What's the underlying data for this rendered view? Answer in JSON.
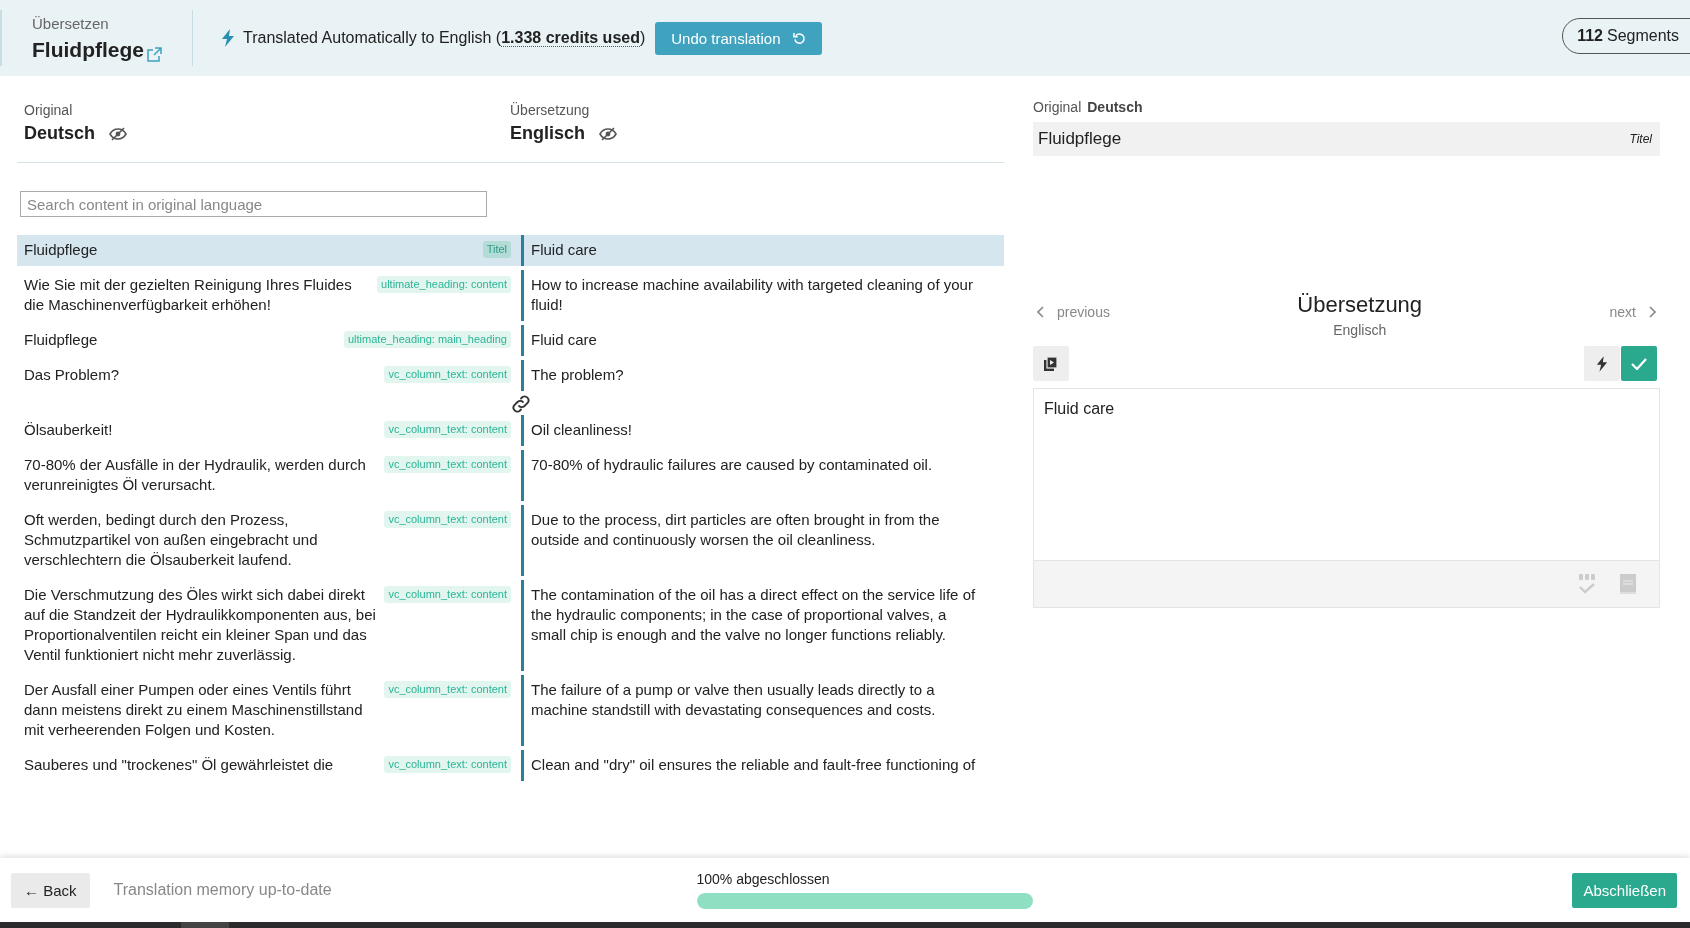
{
  "header": {
    "section": "Übersetzen",
    "title": "Fluidpflege",
    "notice": "Translated Automatically to English (",
    "credits": "1.338 credits used",
    "notice_end": ")",
    "undo_button": "Undo translation",
    "segment_count": "112",
    "segment_label": "Segments"
  },
  "languages": [
    {
      "label": "Original",
      "name": "Deutsch"
    },
    {
      "label": "Übersetzung",
      "name": "Englisch"
    }
  ],
  "search": {
    "placeholder": "Search content in original language"
  },
  "segments": [
    {
      "kind": "segment",
      "source": "Fluidpflege",
      "tag": "Titel",
      "target": "Fluid care",
      "selected": true
    },
    {
      "kind": "segment",
      "source": "Wie Sie mit der gezielten Reinigung Ihres Fluides die Maschinenverfügbarkeit erhöhen!",
      "tag": "ultimate_heading: content",
      "target": "How to increase machine availability with targeted cleaning of your fluid!",
      "selected": false
    },
    {
      "kind": "segment",
      "source": "Fluidpflege",
      "tag": "ultimate_heading: main_heading",
      "target": "Fluid care",
      "selected": false
    },
    {
      "kind": "segment",
      "source": "Das Problem?",
      "tag": "vc_column_text: content",
      "target": "The problem?",
      "selected": false
    },
    {
      "kind": "link"
    },
    {
      "kind": "segment",
      "source": "Ölsauberkeit!",
      "tag": "vc_column_text: content",
      "target": "Oil cleanliness!",
      "selected": false
    },
    {
      "kind": "segment",
      "source": "70-80% der Ausfälle in der Hydraulik, werden durch verunreinigtes Öl verursacht.",
      "tag": "vc_column_text: content",
      "target": "70-80% of hydraulic failures are caused by contaminated oil.",
      "selected": false
    },
    {
      "kind": "segment",
      "source": "Oft werden, bedingt durch den Prozess, Schmutzpartikel von außen eingebracht und verschlechtern die Ölsauberkeit laufend.",
      "tag": "vc_column_text: content",
      "target": "Due to the process, dirt particles are often brought in from the outside and continuously worsen the oil cleanliness.",
      "selected": false
    },
    {
      "kind": "segment",
      "source": "Die Verschmutzung des Öles wirkt sich dabei direkt auf die Standzeit der Hydraulikkomponenten aus, bei Proportionalventilen reicht ein kleiner Span und das Ventil funktioniert nicht mehr zuverlässig.",
      "tag": "vc_column_text: content",
      "target": "The contamination of the oil has a direct effect on the service life of the hydraulic components; in the case of proportional valves, a small chip is enough and the valve no longer functions reliably.",
      "selected": false
    },
    {
      "kind": "segment",
      "source": "Der Ausfall einer Pumpen oder eines Ventils führt dann meistens direkt zu einem Maschinenstillstand mit verheerenden Folgen und Kosten.",
      "tag": "vc_column_text: content",
      "target": "The failure of a pump or valve then usually leads directly to a machine standstill with devastating consequences and costs.",
      "selected": false
    },
    {
      "kind": "segment",
      "source": "Sauberes und \"trockenes\" Öl gewährleistet die",
      "tag": "vc_column_text: content",
      "target": "Clean and \"dry\" oil ensures the reliable and fault-free functioning of",
      "selected": false
    }
  ],
  "editor": {
    "original_label": "Original",
    "original_language": "Deutsch",
    "source_text": "Fluidpflege",
    "source_tag": "Titel",
    "previous": "previous",
    "next": "next",
    "title": "Übersetzung",
    "language": "Englisch",
    "value": "Fluid care"
  },
  "footer": {
    "back": "← Back",
    "memory_status": "Translation memory up-to-date",
    "progress_label": "100% abgeschlossen",
    "level": 1.0,
    "finish": "Abschließen"
  }
}
